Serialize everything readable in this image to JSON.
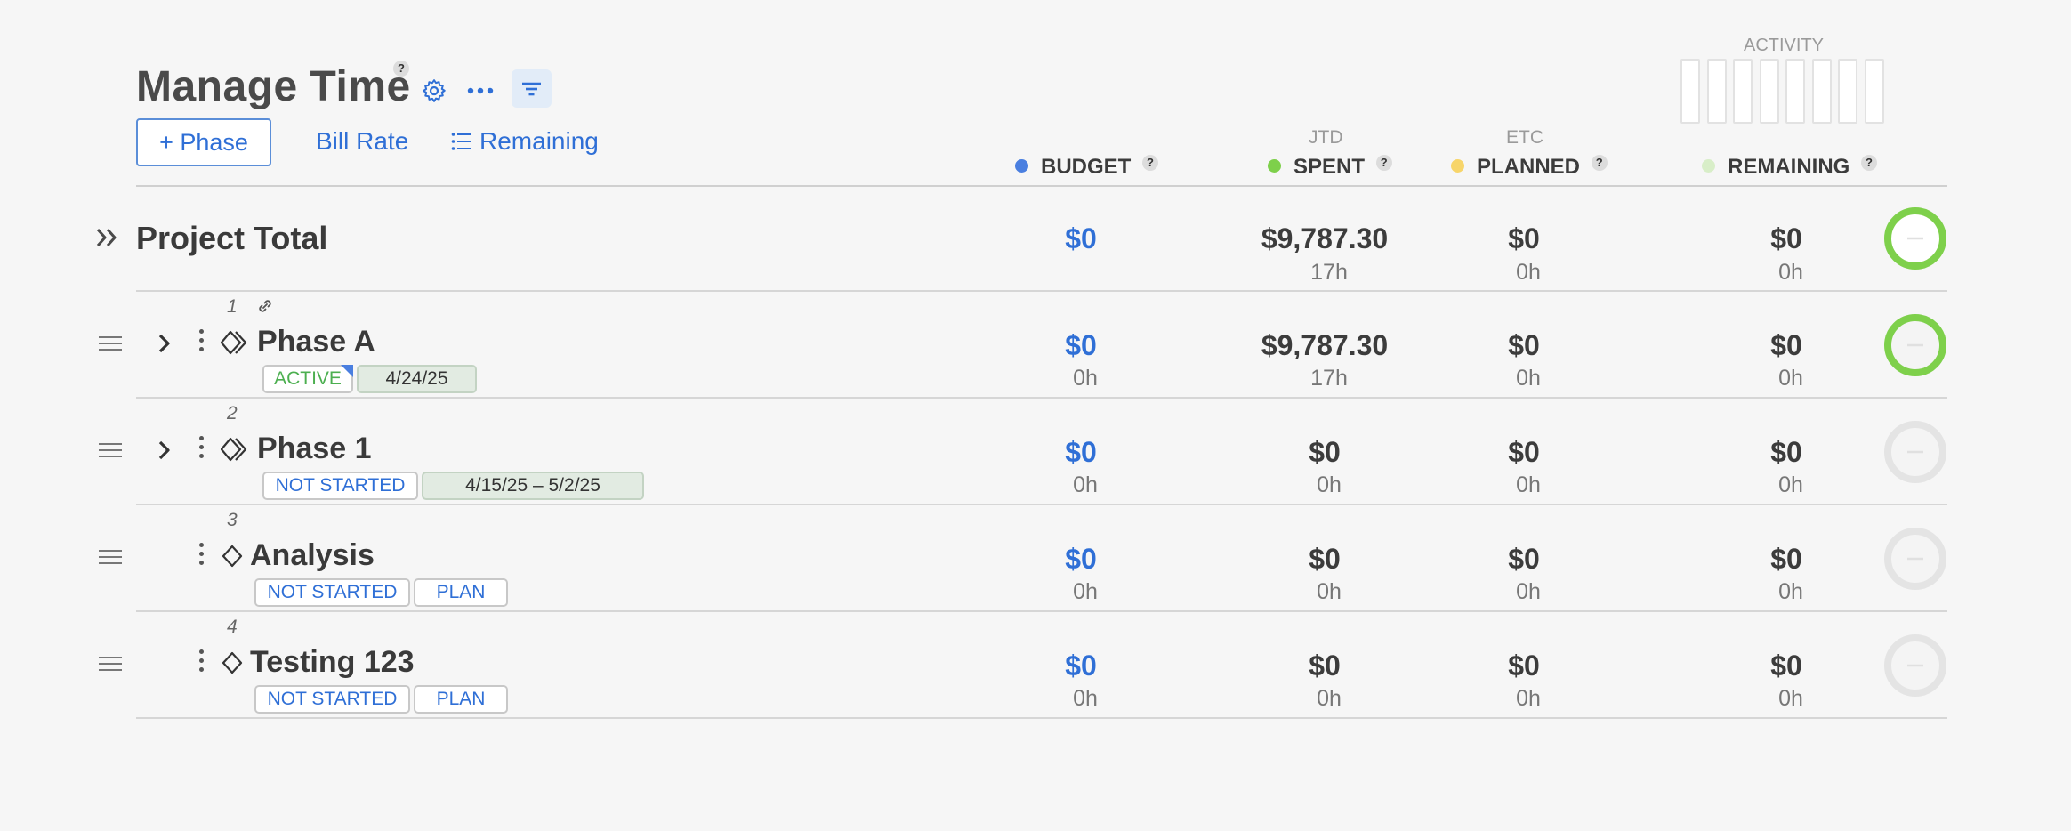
{
  "header": {
    "title": "Manage Time",
    "help": "?",
    "add_phase_label": "+ Phase",
    "bill_rate_label": "Bill Rate",
    "remaining_label": "Remaining"
  },
  "activity": {
    "label": "ACTIVITY",
    "bars": 8
  },
  "columns": {
    "budget": {
      "label": "BUDGET",
      "color": "#4a7fe0"
    },
    "spent": {
      "sub": "JTD",
      "label": "SPENT",
      "color": "#7ed04b"
    },
    "planned": {
      "sub": "ETC",
      "label": "PLANNED",
      "color": "#f7d56a"
    },
    "remaining": {
      "label": "REMAINING",
      "color": "#d8eec8"
    }
  },
  "total": {
    "label": "Project Total",
    "budget": "$0",
    "spent": "$9,787.30",
    "spent_hours": "17h",
    "planned": "$0",
    "planned_hours": "0h",
    "remaining": "$0",
    "remaining_hours": "0h",
    "ring_color": "#7ed04b"
  },
  "rows": [
    {
      "num": "1",
      "name": "Phase A",
      "status": "ACTIVE",
      "date": "4/24/25",
      "budget": "$0",
      "budget_hours": "0h",
      "spent": "$9,787.30",
      "spent_hours": "17h",
      "planned": "$0",
      "planned_hours": "0h",
      "remaining": "$0",
      "remaining_hours": "0h",
      "ring_color": "#7ed04b"
    },
    {
      "num": "2",
      "name": "Phase 1",
      "status": "NOT STARTED",
      "date": "4/15/25   –   5/2/25",
      "budget": "$0",
      "budget_hours": "0h",
      "spent": "$0",
      "spent_hours": "0h",
      "planned": "$0",
      "planned_hours": "0h",
      "remaining": "$0",
      "remaining_hours": "0h",
      "ring_color": "#e4e4e4"
    },
    {
      "num": "3",
      "name": "Analysis",
      "status": "NOT STARTED",
      "plan": "PLAN",
      "budget": "$0",
      "budget_hours": "0h",
      "spent": "$0",
      "spent_hours": "0h",
      "planned": "$0",
      "planned_hours": "0h",
      "remaining": "$0",
      "remaining_hours": "0h",
      "ring_color": "#e4e4e4"
    },
    {
      "num": "4",
      "name": "Testing 123",
      "status": "NOT STARTED",
      "plan": "PLAN",
      "budget": "$0",
      "budget_hours": "0h",
      "spent": "$0",
      "spent_hours": "0h",
      "planned": "$0",
      "planned_hours": "0h",
      "remaining": "$0",
      "remaining_hours": "0h",
      "ring_color": "#e4e4e4"
    }
  ]
}
